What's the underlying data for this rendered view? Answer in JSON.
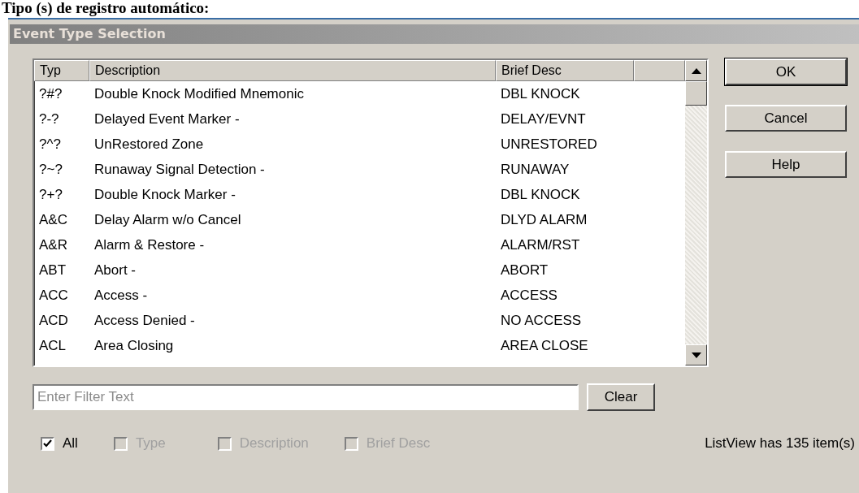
{
  "heading": "Tipo (s) de registro automático:",
  "window": {
    "title": "Event Type Selection"
  },
  "table": {
    "columns": [
      "Typ",
      "Description",
      "Brief Desc"
    ],
    "rows": [
      {
        "typ": "?#?",
        "description": "Double Knock Modified Mnemonic",
        "brief": "DBL KNOCK"
      },
      {
        "typ": "?-?",
        "description": "Delayed Event Marker -",
        "brief": "DELAY/EVNT"
      },
      {
        "typ": "?^?",
        "description": "UnRestored Zone",
        "brief": "UNRESTORED"
      },
      {
        "typ": "?~?",
        "description": "Runaway Signal Detection -",
        "brief": "RUNAWAY"
      },
      {
        "typ": "?+?",
        "description": "Double Knock Marker -",
        "brief": "DBL KNOCK"
      },
      {
        "typ": "A&C",
        "description": "Delay Alarm w/o Cancel",
        "brief": "DLYD ALARM"
      },
      {
        "typ": "A&R",
        "description": "Alarm & Restore -",
        "brief": "ALARM/RST"
      },
      {
        "typ": "ABT",
        "description": "Abort -",
        "brief": "ABORT"
      },
      {
        "typ": "ACC",
        "description": "Access -",
        "brief": "ACCESS"
      },
      {
        "typ": "ACD",
        "description": "Access Denied -",
        "brief": "NO ACCESS"
      },
      {
        "typ": "ACL",
        "description": "Area Closing",
        "brief": "AREA CLOSE"
      }
    ]
  },
  "buttons": [
    {
      "label": "OK",
      "default": true
    },
    {
      "label": "Cancel",
      "default": false
    },
    {
      "label": "Help",
      "default": false
    }
  ],
  "filter": {
    "placeholder": "Enter Filter Text",
    "button": "Clear"
  },
  "checkboxes": [
    {
      "label": "All",
      "checked": true,
      "disabled": false
    },
    {
      "label": "Type",
      "checked": false,
      "disabled": true
    },
    {
      "label": "Description",
      "checked": false,
      "disabled": true
    },
    {
      "label": "Brief Desc",
      "checked": false,
      "disabled": true
    }
  ],
  "status": "ListView has 135 item(s)"
}
